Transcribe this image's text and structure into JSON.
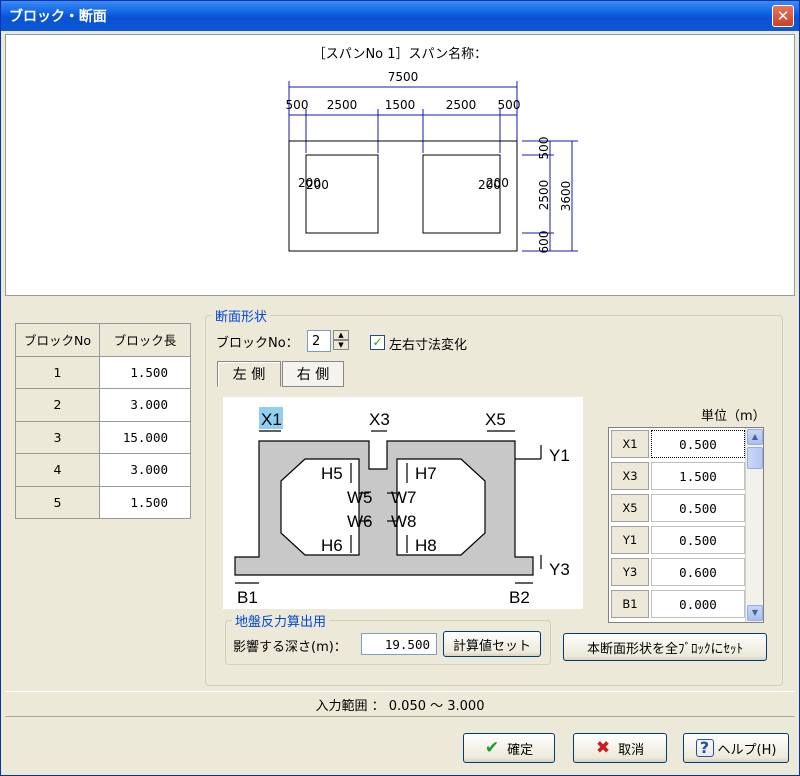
{
  "window": {
    "title": "ブロック・断面",
    "close_glyph": "✕"
  },
  "preview": {
    "caption": "［スパンNo 1］スパン名称：",
    "dims": {
      "total": "7500",
      "top": [
        "500",
        "2500",
        "1500",
        "2500",
        "500"
      ],
      "right": [
        "500",
        "2500",
        "600"
      ],
      "right_total": "3600",
      "chamfer": "200"
    }
  },
  "block_table": {
    "headers": [
      "ブロックNo",
      "ブロック長"
    ],
    "rows": [
      {
        "no": "1",
        "len": "1.500"
      },
      {
        "no": "2",
        "len": "3.000"
      },
      {
        "no": "3",
        "len": "15.000"
      },
      {
        "no": "4",
        "len": "3.000"
      },
      {
        "no": "5",
        "len": "1.500"
      }
    ]
  },
  "section": {
    "legend": "断面形状",
    "block_no_label": "ブロックNo：",
    "block_no_value": "2",
    "lr_change_label": "左右寸法変化",
    "lr_change_checked": "✓",
    "tabs": [
      "左 側",
      "右 側"
    ],
    "unit_label": "単位（m）",
    "diagram_labels": {
      "X1": "X1",
      "X3": "X3",
      "X5": "X5",
      "Y1": "Y1",
      "Y3": "Y3",
      "H5": "H5",
      "H6": "H6",
      "H7": "H7",
      "H8": "H8",
      "W5": "W5",
      "W6": "W6",
      "W7": "W7",
      "W8": "W8",
      "B1": "B1",
      "B2": "B2"
    },
    "params": [
      {
        "name": "X1",
        "value": "0.500"
      },
      {
        "name": "X3",
        "value": "1.500"
      },
      {
        "name": "X5",
        "value": "0.500"
      },
      {
        "name": "Y1",
        "value": "0.500"
      },
      {
        "name": "Y3",
        "value": "0.600"
      },
      {
        "name": "B1",
        "value": "0.000"
      }
    ],
    "set_all_button": "本断面形状を全ﾌﾞﾛｯｸにｾｯﾄ"
  },
  "ground": {
    "legend": "地盤反力算出用",
    "depth_label": "影響する深さ(m)：",
    "depth_value": "19.500",
    "calc_button": "計算値セット"
  },
  "status": {
    "range_text": "入力範囲 ： 0.050 ～ 3.000"
  },
  "footer": {
    "ok": "確定",
    "cancel": "取消",
    "help": "ヘルプ(H)"
  }
}
